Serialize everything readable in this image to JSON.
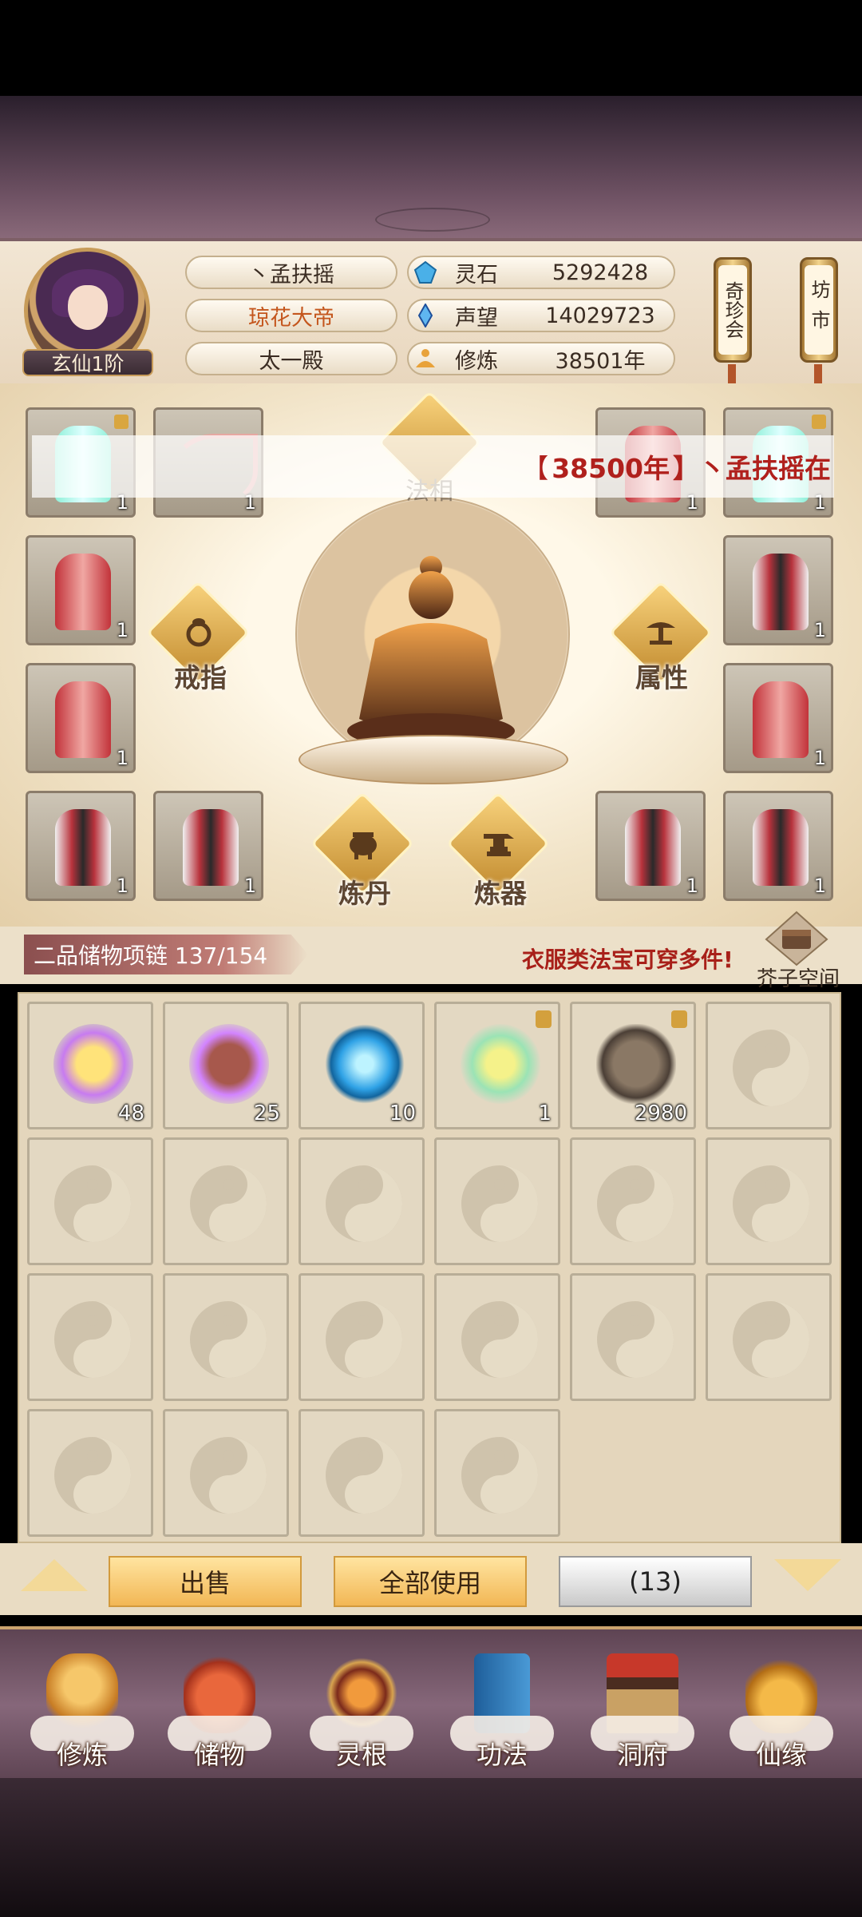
{
  "player": {
    "name": "丶孟扶摇",
    "title": "琼花大帝",
    "sect": "太一殿",
    "rank": "玄仙1阶"
  },
  "resources": [
    {
      "label": "灵石",
      "value": "5292428",
      "icon": "spirit-stone-icon"
    },
    {
      "label": "声望",
      "value": "14029723",
      "icon": "prestige-crystal-icon"
    },
    {
      "label": "修炼",
      "value": "38501年",
      "icon": "meditation-icon"
    }
  ],
  "side_buttons": {
    "treasure": "奇珍会",
    "market": "坊市"
  },
  "marquee": {
    "prefix": "【",
    "years": "38500年",
    "suffix": "】丶孟扶摇在"
  },
  "equip": {
    "top_center_label": "法相",
    "ring_label": "戒指",
    "attr_label": "属性",
    "alchemy_label": "炼丹",
    "forge_label": "炼器",
    "slot_count": "1"
  },
  "bag": {
    "title": "二品储物项链 137/154",
    "tip": "衣服类法宝可穿多件!",
    "space_label": "芥子空间",
    "items": [
      {
        "name": "gold-talisman",
        "count": "48",
        "locked": false
      },
      {
        "name": "purple-orb",
        "count": "25",
        "locked": false
      },
      {
        "name": "blue-vortex-orb",
        "count": "10",
        "locked": false
      },
      {
        "name": "jade-gourd",
        "count": "1",
        "locked": true
      },
      {
        "name": "ore-chunk",
        "count": "2980",
        "locked": true
      }
    ]
  },
  "actions": {
    "sell": "出售",
    "use_all": "全部使用",
    "count": "(13)"
  },
  "nav": [
    {
      "label": "修炼"
    },
    {
      "label": "储物"
    },
    {
      "label": "灵根"
    },
    {
      "label": "功法"
    },
    {
      "label": "洞府"
    },
    {
      "label": "仙缘"
    }
  ],
  "colors": {
    "accent_gold": "#f2b755",
    "tip_red": "#a82019",
    "title_orange": "#c4561d"
  }
}
